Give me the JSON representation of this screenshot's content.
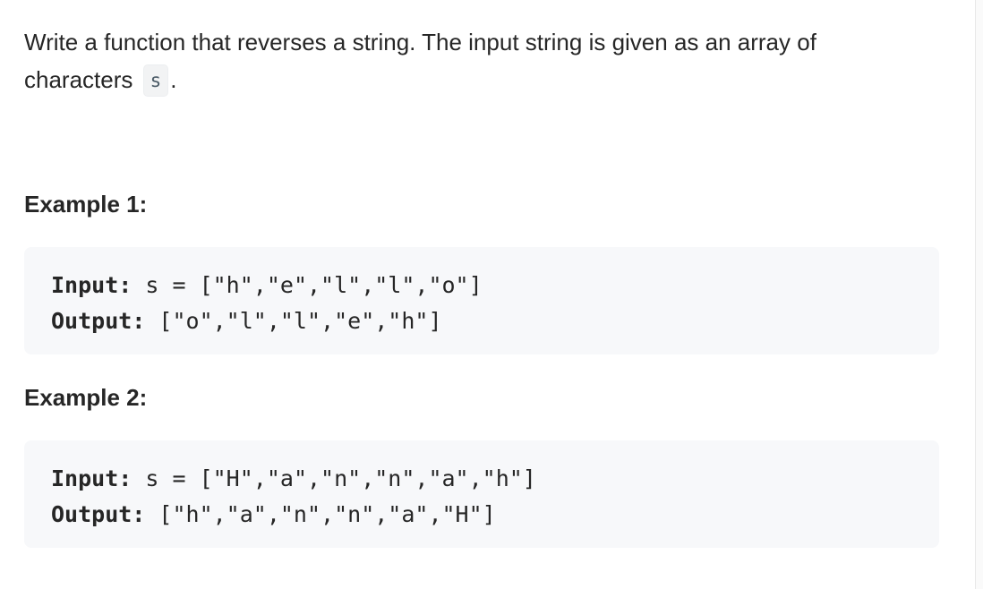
{
  "problem": {
    "description_before_code": "Write a function that reverses a string. The input string is given as an array of characters",
    "inline_code": "s",
    "description_after_code": "."
  },
  "examples": [
    {
      "heading": "Example 1:",
      "input_label": "Input:",
      "input_value": "s = [\"h\",\"e\",\"l\",\"l\",\"o\"]",
      "output_label": "Output:",
      "output_value": "[\"o\",\"l\",\"l\",\"e\",\"h\"]"
    },
    {
      "heading": "Example 2:",
      "input_label": "Input:",
      "input_value": "s = [\"H\",\"a\",\"n\",\"n\",\"a\",\"h\"]",
      "output_label": "Output:",
      "output_value": "[\"h\",\"a\",\"n\",\"n\",\"a\",\"H\"]"
    }
  ]
}
